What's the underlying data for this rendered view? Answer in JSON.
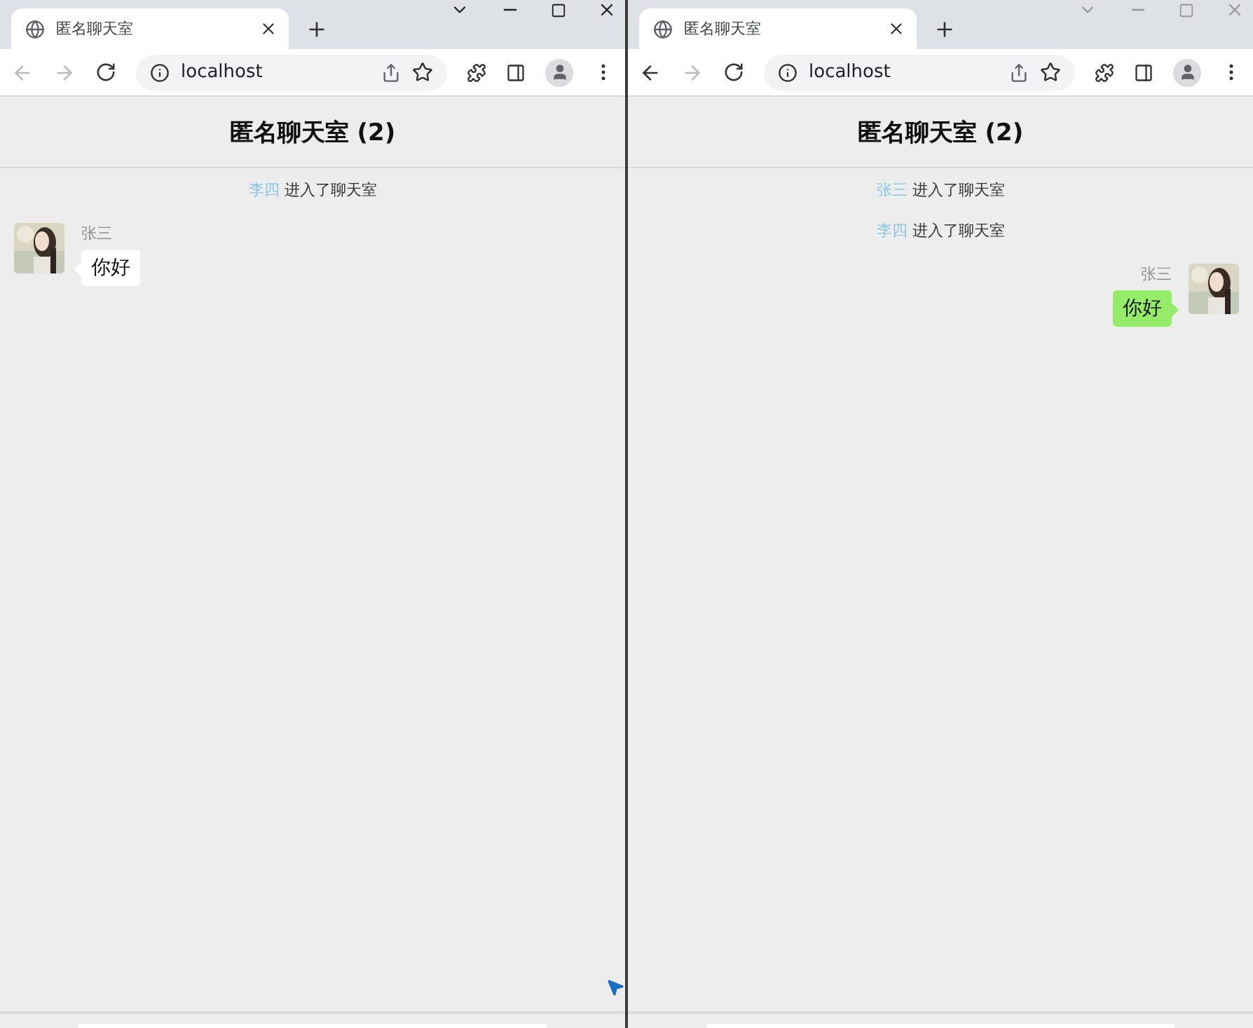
{
  "windows": [
    {
      "active": true,
      "tab": {
        "title": "匿名聊天室"
      },
      "address": "localhost",
      "back_enabled": false,
      "room_title": "匿名聊天室 (2)",
      "messages": [
        {
          "kind": "join",
          "name": "李四",
          "text": "进入了聊天室"
        },
        {
          "kind": "chat",
          "own": false,
          "name": "张三",
          "text": "你好"
        }
      ]
    },
    {
      "active": false,
      "tab": {
        "title": "匿名聊天室"
      },
      "address": "localhost",
      "back_enabled": true,
      "room_title": "匿名聊天室 (2)",
      "messages": [
        {
          "kind": "join",
          "name": "张三",
          "text": "进入了聊天室"
        },
        {
          "kind": "join",
          "name": "李四",
          "text": "进入了聊天室"
        },
        {
          "kind": "chat",
          "own": true,
          "name": "张三",
          "text": "你好"
        }
      ]
    }
  ]
}
